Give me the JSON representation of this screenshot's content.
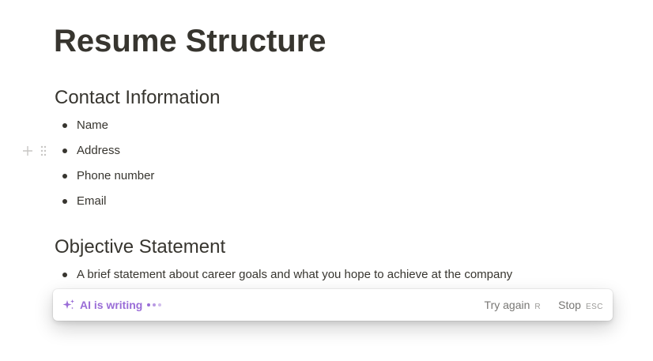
{
  "page": {
    "title": "Resume Structure"
  },
  "sections": [
    {
      "heading": "Contact Information",
      "items": [
        "Name",
        "Address",
        "Phone number",
        "Email"
      ]
    },
    {
      "heading": "Objective Statement",
      "items": [
        "A brief statement about career goals and what you hope to achieve at the company"
      ]
    }
  ],
  "block_handle": {
    "add_icon": "plus-icon",
    "drag_icon": "drag-handle-icon"
  },
  "ai_bar": {
    "status": "AI is writing",
    "status_icon": "sparkle-icon",
    "accent_color": "#9a6dd7",
    "actions": [
      {
        "label": "Try again",
        "shortcut": "R"
      },
      {
        "label": "Stop",
        "shortcut": "ESC"
      }
    ]
  },
  "colors": {
    "text": "#37352f",
    "muted": "#787774",
    "handle": "#c7c6c4"
  }
}
